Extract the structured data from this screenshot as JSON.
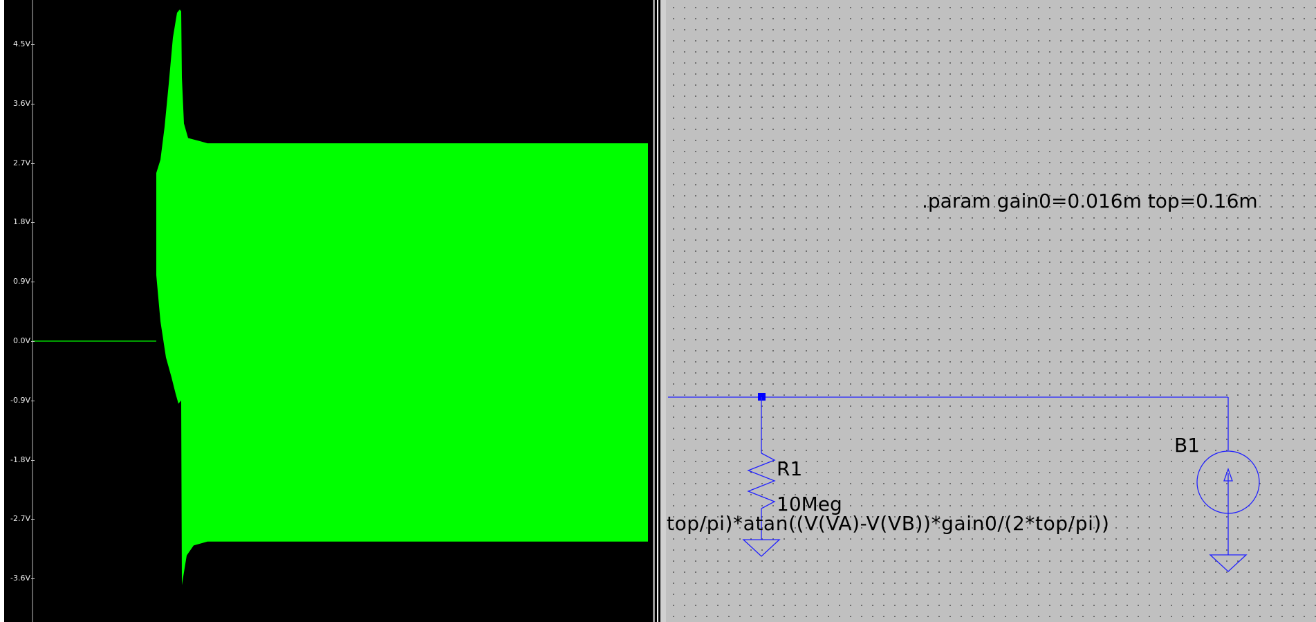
{
  "waveform_viewer": {
    "trace_color": "#00ff00",
    "background": "#000000",
    "y_axis_ticks": [
      "4.5V",
      "3.6V",
      "2.7V",
      "1.8V",
      "0.9V",
      "0.0V",
      "-0.9V",
      "-1.8V",
      "-2.7V",
      "-3.6V"
    ]
  },
  "chart_data": {
    "type": "line",
    "title": "",
    "xlabel": "",
    "ylabel": "",
    "y_tick_labels": [
      "4.5V",
      "3.6V",
      "2.7V",
      "1.8V",
      "0.9V",
      "0.0V",
      "-0.9V",
      "-1.8V",
      "-2.7V",
      "-3.6V"
    ],
    "ylim": [
      -4.2,
      5.2
    ],
    "series": [
      {
        "color": "#00ff00",
        "envelope_points": [
          {
            "y_min": 0.0,
            "y_max": 0.0
          },
          {
            "y_min": 0.0,
            "y_max": 0.0
          },
          {
            "y_min": -0.6,
            "y_max": 2.65
          },
          {
            "y_min": -0.95,
            "y_max": 5.0
          },
          {
            "y_min": -3.65,
            "y_max": 3.05
          },
          {
            "y_min": -3.05,
            "y_max": 3.0
          },
          {
            "y_min": -3.05,
            "y_max": 3.0
          }
        ]
      }
    ]
  },
  "schematic": {
    "background": "#c0c0c0",
    "wire_color": "#0000ff",
    "param_directive": ".param gain0=0.016m top=0.16m",
    "resistor": {
      "ref": "R1",
      "value": "10Meg"
    },
    "source": {
      "ref": "B1",
      "expression": "top/pi)*atan((V(VA)-V(VB))*gain0/(2*top/pi))"
    }
  }
}
